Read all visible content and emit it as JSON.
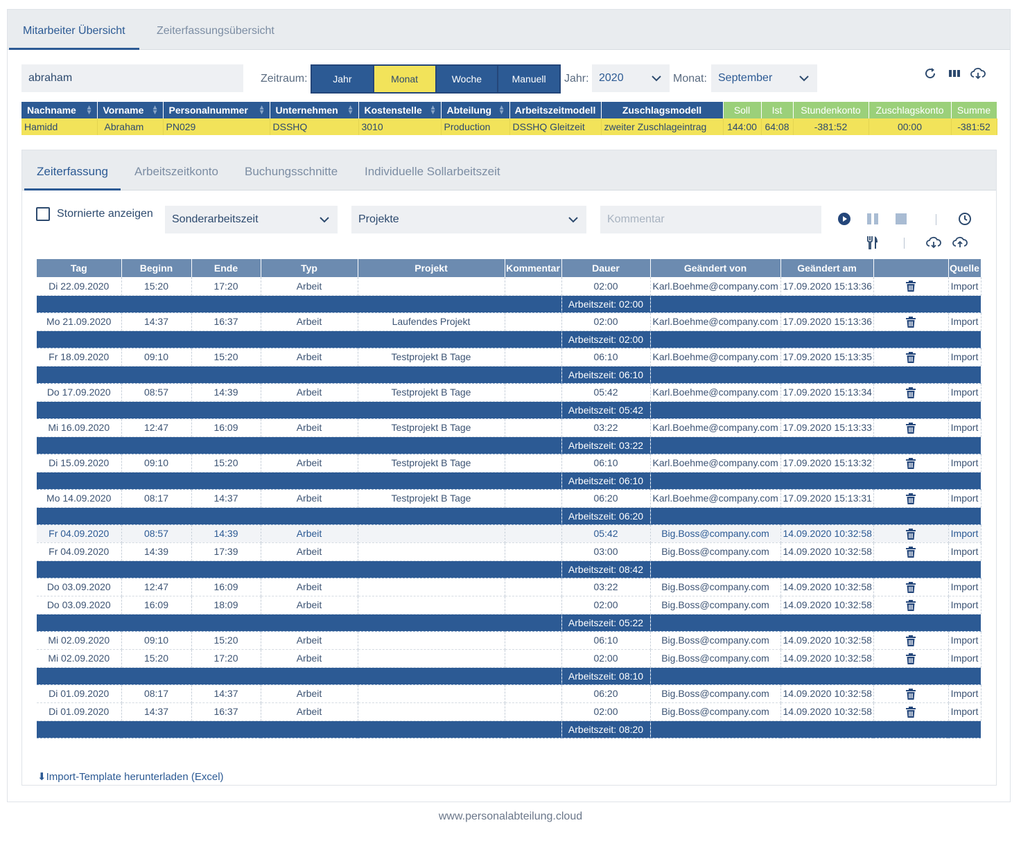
{
  "top_tabs": [
    "Mitarbeiter Übersicht",
    "Zeiterfassungsübersicht"
  ],
  "search": {
    "value": "abraham"
  },
  "filters": {
    "zeitraum_label": "Zeitraum:",
    "zeitraum_options": [
      "Jahr",
      "Monat",
      "Woche",
      "Manuell"
    ],
    "zeitraum_selected": "Monat",
    "jahr_label": "Jahr:",
    "jahr_value": "2020",
    "monat_label": "Monat:",
    "monat_value": "September"
  },
  "toolbar_icons": [
    "refresh-icon",
    "columns-icon",
    "cloud-download-icon"
  ],
  "employee_table": {
    "headers": [
      "Nachname",
      "Vorname",
      "Personalnummer",
      "Unternehmen",
      "Kostenstelle",
      "Abteilung",
      "Arbeitszeitmodell",
      "Zuschlagsmodell",
      "Soll",
      "Ist",
      "Stundenkonto",
      "Zuschlagskonto",
      "Summe"
    ],
    "row": [
      "Hamidd",
      "Abraham",
      "PN029",
      "DSSHQ",
      "3010",
      "Production",
      "DSSHQ Gleitzeit",
      "zweiter Zuschlageintrag",
      "144:00",
      "64:08",
      "-381:52",
      "00:00",
      "-381:52"
    ],
    "colors": {
      "header": "#2c5a94",
      "header_summary": "#9bd07a",
      "row": "#f2e35a"
    }
  },
  "inner_tabs": [
    "Zeiterfassung",
    "Arbeitszeitkonto",
    "Buchungsschnitte",
    "Individuelle Sollarbeitszeit"
  ],
  "controls": {
    "checkbox_label": "Stornierte anzeigen",
    "sonder_select": "Sonderarbeitszeit",
    "projekte_select": "Projekte",
    "kommentar_placeholder": "Kommentar"
  },
  "time_table": {
    "headers": [
      "Tag",
      "Beginn",
      "Ende",
      "Typ",
      "Projekt",
      "Kommentar",
      "Dauer",
      "Geändert von",
      "Geändert am",
      "",
      "Quelle"
    ],
    "groups": [
      {
        "rows": [
          [
            "Di 22.09.2020",
            "15:20",
            "17:20",
            "Arbeit",
            "",
            "",
            "02:00",
            "Karl.Boehme@company.com",
            "17.09.2020 15:13:36",
            "Import"
          ]
        ],
        "sum": "Arbeitszeit: 02:00"
      },
      {
        "rows": [
          [
            "Mo 21.09.2020",
            "14:37",
            "16:37",
            "Arbeit",
            "Laufendes Projekt",
            "",
            "02:00",
            "Karl.Boehme@company.com",
            "17.09.2020 15:13:36",
            "Import"
          ]
        ],
        "sum": "Arbeitszeit: 02:00"
      },
      {
        "rows": [
          [
            "Fr 18.09.2020",
            "09:10",
            "15:20",
            "Arbeit",
            "Testprojekt B Tage",
            "",
            "06:10",
            "Karl.Boehme@company.com",
            "17.09.2020 15:13:35",
            "Import"
          ]
        ],
        "sum": "Arbeitszeit: 06:10"
      },
      {
        "rows": [
          [
            "Do 17.09.2020",
            "08:57",
            "14:39",
            "Arbeit",
            "Testprojekt B Tage",
            "",
            "05:42",
            "Karl.Boehme@company.com",
            "17.09.2020 15:13:34",
            "Import"
          ]
        ],
        "sum": "Arbeitszeit: 05:42"
      },
      {
        "rows": [
          [
            "Mi 16.09.2020",
            "12:47",
            "16:09",
            "Arbeit",
            "Testprojekt B Tage",
            "",
            "03:22",
            "Karl.Boehme@company.com",
            "17.09.2020 15:13:33",
            "Import"
          ]
        ],
        "sum": "Arbeitszeit: 03:22"
      },
      {
        "rows": [
          [
            "Di 15.09.2020",
            "09:10",
            "15:20",
            "Arbeit",
            "Testprojekt B Tage",
            "",
            "06:10",
            "Karl.Boehme@company.com",
            "17.09.2020 15:13:32",
            "Import"
          ]
        ],
        "sum": "Arbeitszeit: 06:10"
      },
      {
        "rows": [
          [
            "Mo 14.09.2020",
            "08:17",
            "14:37",
            "Arbeit",
            "Testprojekt B Tage",
            "",
            "06:20",
            "Karl.Boehme@company.com",
            "17.09.2020 15:13:31",
            "Import"
          ]
        ],
        "sum": "Arbeitszeit: 06:20"
      },
      {
        "rows": [
          [
            "Fr 04.09.2020",
            "08:57",
            "14:39",
            "Arbeit",
            "",
            "",
            "05:42",
            "Big.Boss@company.com",
            "14.09.2020 10:32:58",
            "Import"
          ],
          [
            "Fr 04.09.2020",
            "14:39",
            "17:39",
            "Arbeit",
            "",
            "",
            "03:00",
            "Big.Boss@company.com",
            "14.09.2020 10:32:58",
            "Import"
          ]
        ],
        "sum": "Arbeitszeit: 08:42",
        "highlight_first": true
      },
      {
        "rows": [
          [
            "Do 03.09.2020",
            "12:47",
            "16:09",
            "Arbeit",
            "",
            "",
            "03:22",
            "Big.Boss@company.com",
            "14.09.2020 10:32:58",
            "Import"
          ],
          [
            "Do 03.09.2020",
            "16:09",
            "18:09",
            "Arbeit",
            "",
            "",
            "02:00",
            "Big.Boss@company.com",
            "14.09.2020 10:32:58",
            "Import"
          ]
        ],
        "sum": "Arbeitszeit: 05:22"
      },
      {
        "rows": [
          [
            "Mi 02.09.2020",
            "09:10",
            "15:20",
            "Arbeit",
            "",
            "",
            "06:10",
            "Big.Boss@company.com",
            "14.09.2020 10:32:58",
            "Import"
          ],
          [
            "Mi 02.09.2020",
            "15:20",
            "17:20",
            "Arbeit",
            "",
            "",
            "02:00",
            "Big.Boss@company.com",
            "14.09.2020 10:32:58",
            "Import"
          ]
        ],
        "sum": "Arbeitszeit: 08:10"
      },
      {
        "rows": [
          [
            "Di 01.09.2020",
            "08:17",
            "14:37",
            "Arbeit",
            "",
            "",
            "06:20",
            "Big.Boss@company.com",
            "14.09.2020 10:32:58",
            "Import"
          ],
          [
            "Di 01.09.2020",
            "14:37",
            "16:37",
            "Arbeit",
            "",
            "",
            "02:00",
            "Big.Boss@company.com",
            "14.09.2020 10:32:58",
            "Import"
          ]
        ],
        "sum": "Arbeitszeit: 08:20"
      }
    ]
  },
  "import_link": "Import-Template herunterladen (Excel)",
  "footer": "www.personalabteilung.cloud"
}
